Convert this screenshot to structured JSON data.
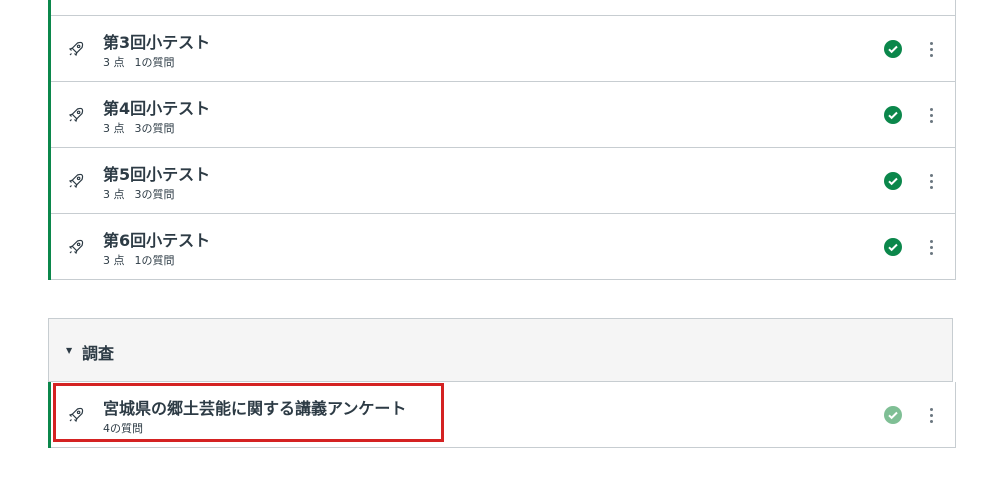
{
  "quizzes": [
    {
      "title": "第3回小テスト",
      "points": "3 点",
      "questions": "1の質問"
    },
    {
      "title": "第4回小テスト",
      "points": "3 点",
      "questions": "3の質問"
    },
    {
      "title": "第5回小テスト",
      "points": "3 点",
      "questions": "3の質問"
    },
    {
      "title": "第6回小テスト",
      "points": "3 点",
      "questions": "1の質問"
    }
  ],
  "survey_section": {
    "title": "調査",
    "items": [
      {
        "title": "宮城県の郷土芸能に関する講義アンケート",
        "questions": "4の質問"
      }
    ]
  },
  "colors": {
    "accent_green": "#0b874b",
    "published_check": "#0b874b",
    "published_check_faded": "#7fbf95",
    "highlight_red": "#d42222"
  },
  "icons": {
    "item": "rocket-icon",
    "status": "published-check-icon",
    "menu": "kebab-menu-icon"
  }
}
